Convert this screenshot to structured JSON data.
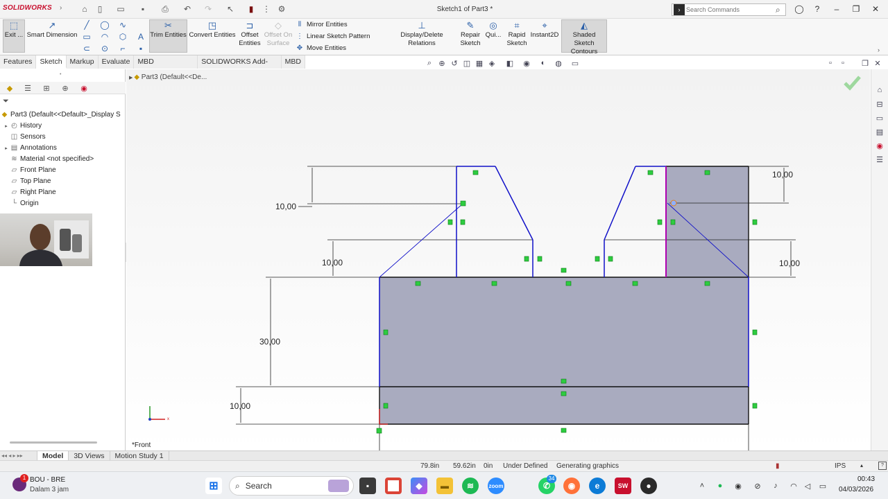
{
  "window": {
    "app_name": "SOLIDWORKS",
    "title": "Sketch1 of Part3 *",
    "search_placeholder": "Search Commands"
  },
  "ribbon": {
    "exit_label": "Exit ...",
    "smart_dimension": "Smart Dimension",
    "trim_entities": "Trim Entities",
    "convert_entities": "Convert Entities",
    "offset_entities_1": "Offset",
    "offset_entities_2": "Entities",
    "offset_surface_1": "Offset On",
    "offset_surface_2": "Surface",
    "mirror_entities": "Mirror Entities",
    "linear_sketch_pattern": "Linear Sketch Pattern",
    "move_entities": "Move Entities",
    "display_delete_relations": "Display/Delete Relations",
    "repair_sketch_1": "Repair",
    "repair_sketch_2": "Sketch",
    "quick_snaps": "Qui...",
    "rapid_sketch_1": "Rapid",
    "rapid_sketch_2": "Sketch",
    "instant2d": "Instant2D",
    "shaded_contours_1": "Shaded Sketch",
    "shaded_contours_2": "Contours"
  },
  "tabs": [
    "Features",
    "Sketch",
    "Markup",
    "Evaluate",
    "MBD Dimensions",
    "SOLIDWORKS Add-Ins",
    "MBD"
  ],
  "active_tab": "Sketch",
  "tree": {
    "root": "Part3  (Default<<Default>_Display S",
    "items": [
      {
        "label": "History",
        "icon": "history-icon",
        "expandable": true
      },
      {
        "label": "Sensors",
        "icon": "sensors-icon",
        "expandable": false
      },
      {
        "label": "Annotations",
        "icon": "annotations-icon",
        "expandable": true
      },
      {
        "label": "Material <not specified>",
        "icon": "material-icon",
        "expandable": false
      },
      {
        "label": "Front Plane",
        "icon": "plane-icon",
        "expandable": false
      },
      {
        "label": "Top Plane",
        "icon": "plane-icon",
        "expandable": false
      },
      {
        "label": "Right Plane",
        "icon": "plane-icon",
        "expandable": false
      },
      {
        "label": "Origin",
        "icon": "origin-icon",
        "expandable": false
      }
    ]
  },
  "canvas": {
    "breadcrumb": "Part3  (Default<<De...",
    "view_label": "*Front",
    "dimensions": {
      "top_left": "10,00",
      "mid_left": "10,00",
      "base_height": "30,00",
      "bottom": "10,00",
      "top_right": "10,00",
      "mid_right": "10,00"
    }
  },
  "bottom_tabs": [
    "Model",
    "3D Views",
    "Motion Study 1"
  ],
  "active_bottom_tab": "Model",
  "status": {
    "x": "79.8in",
    "y": "59.62in",
    "z": "0in",
    "state": "Under Defined",
    "message": "Generating graphics",
    "units": "IPS"
  },
  "taskbar": {
    "notif_title": "BOU - BRE",
    "notif_sub": "Dalam 3 jam",
    "notif_badge": "1",
    "search_label": "Search",
    "whatsapp_badge": "34",
    "time": "00:43",
    "date": "04/03/2026"
  },
  "colors": {
    "sketch_blue": "#1010c8",
    "fill": "#a9abbf",
    "relation_green": "#2ecc40",
    "selected_magenta": "#b000b0",
    "accent_red": "#c8102e"
  }
}
